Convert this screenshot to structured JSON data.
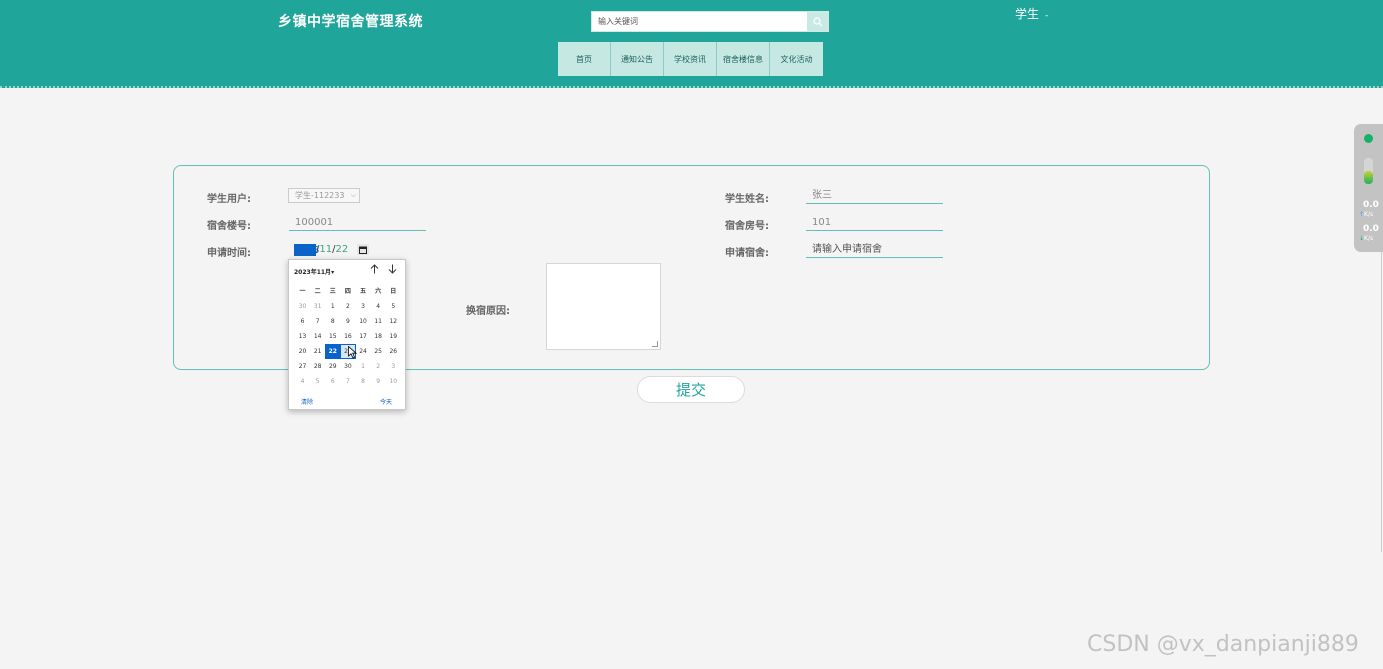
{
  "header": {
    "site_title": "乡镇中学宿舍管理系统",
    "search": {
      "placeholder": "输入关键词"
    },
    "user_menu": {
      "label": "学生",
      "caret": "-"
    },
    "nav": [
      {
        "label": "首页"
      },
      {
        "label": "通知公告"
      },
      {
        "label": "学校资讯"
      },
      {
        "label": "宿舍楼信息"
      },
      {
        "label": "文化活动"
      }
    ],
    "colors": {
      "primary": "#1fa59a",
      "nav_bg": "#c6e8e3",
      "accent_blue": "#0a63c9"
    }
  },
  "form": {
    "student_user": {
      "label": "学生用户:",
      "value": "学生-112233"
    },
    "student_name": {
      "label": "学生姓名:",
      "value": "张三"
    },
    "building_no": {
      "label": "宿舍楼号:",
      "value": "100001"
    },
    "room_no": {
      "label": "宿舍房号:",
      "value": "101"
    },
    "apply_time": {
      "label": "申请时间:",
      "year": "2023",
      "month": "11",
      "day": "22",
      "sep": "/"
    },
    "apply_dorm": {
      "label": "申请宿舍:",
      "placeholder": "请输入申请宿舍"
    },
    "reason": {
      "label": "换宿原因:",
      "value": ""
    },
    "submit_label": "提交"
  },
  "datepicker": {
    "month_label": "2023年11月",
    "month_caret": "▾",
    "prev_icon": "arrow-up-icon",
    "next_icon": "arrow-down-icon",
    "weekdays": [
      "一",
      "二",
      "三",
      "四",
      "五",
      "六",
      "日"
    ],
    "weeks": [
      [
        "30",
        "31",
        "1",
        "2",
        "3",
        "4",
        "5"
      ],
      [
        "6",
        "7",
        "8",
        "9",
        "10",
        "11",
        "12"
      ],
      [
        "13",
        "14",
        "15",
        "16",
        "17",
        "18",
        "19"
      ],
      [
        "20",
        "21",
        "22",
        "23",
        "24",
        "25",
        "26"
      ],
      [
        "27",
        "28",
        "29",
        "30",
        "1",
        "2",
        "3"
      ],
      [
        "4",
        "5",
        "6",
        "7",
        "8",
        "9",
        "10"
      ]
    ],
    "selected": "22",
    "hovered": "23",
    "clear_label": "清除",
    "today_label": "今天"
  },
  "side_widget": {
    "upload": {
      "value": "0.0",
      "unit": "K/s"
    },
    "download": {
      "value": "0.0",
      "unit": "K/s"
    }
  },
  "watermark": "CSDN @vx_danpianji889"
}
